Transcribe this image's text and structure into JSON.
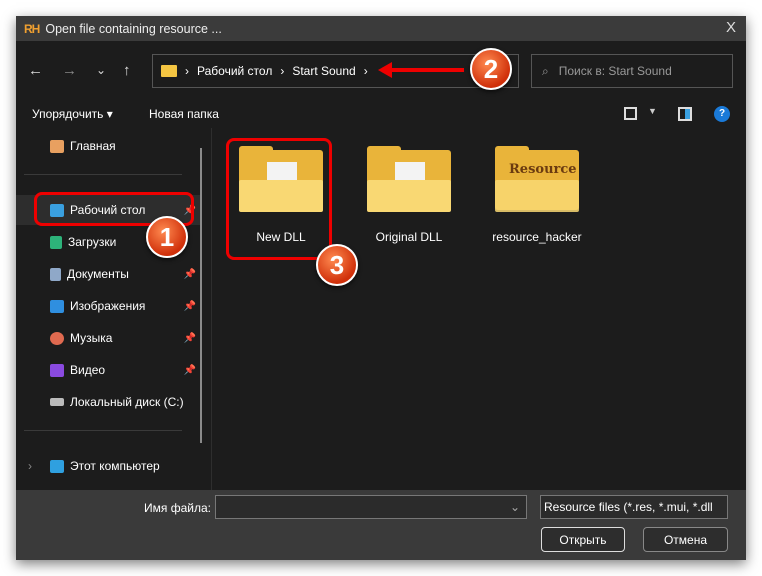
{
  "window": {
    "logo": "RH",
    "title": "Open file containing resource ...",
    "close": "X"
  },
  "nav": {
    "back": "←",
    "forward": "→",
    "recent": "⌄",
    "up": "↑",
    "breadcrumb": [
      "Рабочий стол",
      "Start Sound"
    ],
    "separator": "›",
    "search_placeholder": "Поиск в: Start Sound"
  },
  "toolbar": {
    "organize": "Упорядочить ▾",
    "new_folder": "Новая папка",
    "help": "?"
  },
  "sidebar": {
    "items": [
      {
        "label": "Главная",
        "icon": "home-icon",
        "color": "#e8a060"
      },
      {
        "label": "Рабочий стол",
        "icon": "desktop-icon",
        "color": "#3aa0e0",
        "pinned": true,
        "selected": true
      },
      {
        "label": "Загрузки",
        "icon": "download-icon",
        "color": "#2db37a",
        "pinned": false
      },
      {
        "label": "Документы",
        "icon": "documents-icon",
        "color": "#8fa8c8",
        "pinned": true
      },
      {
        "label": "Изображения",
        "icon": "pictures-icon",
        "color": "#2f8fe0",
        "pinned": true
      },
      {
        "label": "Музыка",
        "icon": "music-icon",
        "color": "#e06a50",
        "pinned": true
      },
      {
        "label": "Видео",
        "icon": "video-icon",
        "color": "#8a4ae0",
        "pinned": true
      },
      {
        "label": "Локальный диск (C:)",
        "icon": "drive-icon",
        "color": "#bbbbbb"
      },
      {
        "label": "Этот компьютер",
        "icon": "computer-icon",
        "color": "#2fa0e0"
      }
    ]
  },
  "files": [
    {
      "name": "New DLL"
    },
    {
      "name": "Original DLL"
    },
    {
      "name": "resource_hacker",
      "overlay": "Resource"
    }
  ],
  "bottom": {
    "filename_label": "Имя файла:",
    "filename_value": "",
    "filter": "Resource files (*.res, *.mui, *.dll",
    "open": "Открыть",
    "cancel": "Отмена"
  },
  "annotations": [
    "1",
    "2",
    "3"
  ],
  "accent": "#e00000"
}
